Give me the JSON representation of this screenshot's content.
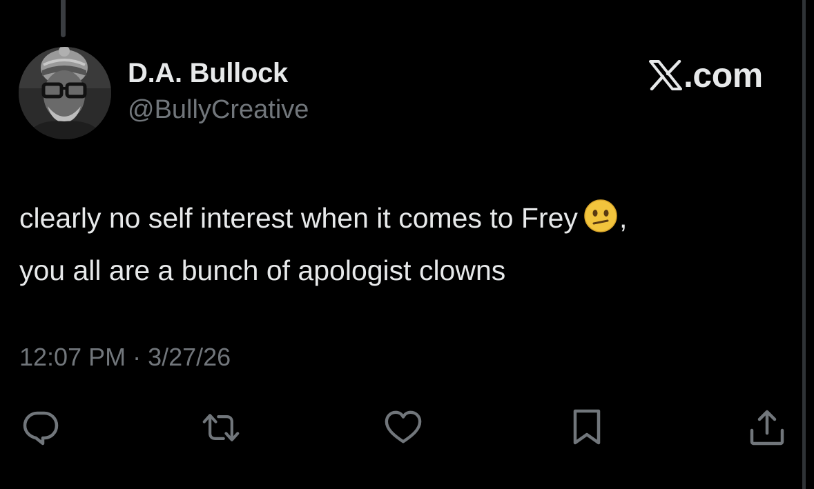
{
  "author": {
    "display_name": "D.A. Bullock",
    "handle": "@BullyCreative",
    "avatar_icon": "avatar-photo"
  },
  "brand": {
    "logo_icon": "x-logo-icon",
    "text": ".com"
  },
  "tweet": {
    "lines": [
      "clearly no self interest when it comes to Frey",
      "you all are a bunch of apologist clowns"
    ],
    "emoji_icon": "confused-face-emoji",
    "emoji_trailing_text": ",",
    "timestamp": "12:07 PM · 3/27/26"
  },
  "actions": [
    {
      "name": "reply",
      "icon": "reply-icon"
    },
    {
      "name": "repost",
      "icon": "repost-icon"
    },
    {
      "name": "like",
      "icon": "heart-icon"
    },
    {
      "name": "bookmark",
      "icon": "bookmark-icon"
    },
    {
      "name": "share",
      "icon": "share-icon"
    }
  ],
  "colors": {
    "background": "#000000",
    "primary_text": "#e7e9ea",
    "secondary_text": "#71767b"
  }
}
